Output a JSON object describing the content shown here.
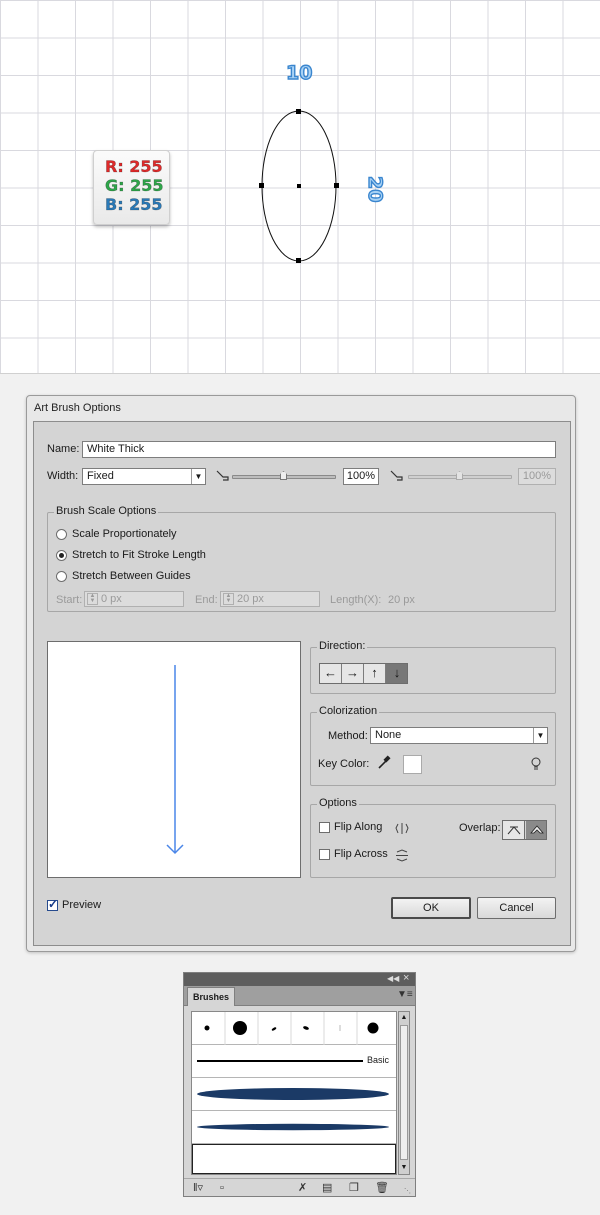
{
  "artboard": {
    "width_label": "10",
    "height_label": "20",
    "color_card": {
      "r": "R: 255",
      "g": "G: 255",
      "b": "B: 255"
    }
  },
  "dialog": {
    "title": "Art Brush Options",
    "name_label": "Name:",
    "name_value": "White Thick",
    "width_label": "Width:",
    "width_option": "Fixed",
    "width_percent": "100%",
    "width_percent_secondary": "100%",
    "width_slider_level": 0.5,
    "width_slider_secondary_level": 0.5,
    "scale_group": {
      "title": "Brush Scale Options",
      "options": [
        {
          "label": "Scale Proportionately",
          "checked": false
        },
        {
          "label": "Stretch to Fit Stroke Length",
          "checked": true
        },
        {
          "label": "Stretch Between Guides",
          "checked": false
        }
      ],
      "start_label": "Start:",
      "start_value": "0 px",
      "end_label": "End:",
      "end_value": "20 px",
      "length_label": "Length(X):",
      "length_value": "20 px"
    },
    "direction": {
      "title": "Direction:",
      "buttons": [
        "←",
        "→",
        "↑",
        "↓"
      ],
      "active_index": 3
    },
    "colorization": {
      "title": "Colorization",
      "method_label": "Method:",
      "method_value": "None",
      "key_color_label": "Key Color:",
      "key_color": "#ffffff"
    },
    "options": {
      "title": "Options",
      "flip_along": "Flip Along",
      "flip_across": "Flip Across",
      "overlap_label": "Overlap:"
    },
    "preview_label": "Preview",
    "preview_checked": true,
    "ok_label": "OK",
    "cancel_label": "Cancel",
    "preview_arrow_color": "#4a86e8"
  },
  "brushes_panel": {
    "tab_label": "Brushes",
    "basic_label": "Basic",
    "stroke_color": "#1b3a66"
  }
}
